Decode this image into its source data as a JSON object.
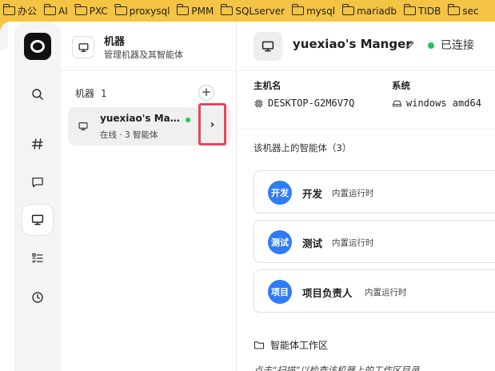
{
  "bookmarks": [
    {
      "label": "办公",
      "icon": "folder-icon"
    },
    {
      "label": "AI",
      "icon": "folder-icon"
    },
    {
      "label": "PXC",
      "icon": "folder-icon"
    },
    {
      "label": "proxysql",
      "icon": "folder-icon"
    },
    {
      "label": "PMM",
      "icon": "folder-icon"
    },
    {
      "label": "SQLserver",
      "icon": "folder-icon"
    },
    {
      "label": "mysql",
      "icon": "folder-icon"
    },
    {
      "label": "mariadb",
      "icon": "folder-icon"
    },
    {
      "label": "TIDB",
      "icon": "folder-icon"
    },
    {
      "label": "sec",
      "icon": "folder-icon"
    }
  ],
  "rail": {
    "items": [
      {
        "name": "search",
        "icon": "search-icon"
      },
      {
        "name": "channels",
        "icon": "hash-icon"
      },
      {
        "name": "chat",
        "icon": "chat-icon"
      },
      {
        "name": "machines",
        "icon": "monitor-icon",
        "active": true
      },
      {
        "name": "tasks",
        "icon": "checklist-icon"
      },
      {
        "name": "history",
        "icon": "clock-icon"
      }
    ]
  },
  "panel": {
    "title": "机器",
    "subtitle": "管理机器及其智能体",
    "list_label": "机器",
    "list_count": "1",
    "add_label": "+",
    "machine": {
      "name": "yuexiao's Mang...",
      "subtitle": "在线 · 3 智能体",
      "status_color": "#22c55e"
    },
    "open_label": "›"
  },
  "detail": {
    "title": "yuexiao's Manger",
    "status": "已连接",
    "status_color": "#22c55e",
    "hostname_label": "主机名",
    "hostname": "DESKTOP-G2M6V7Q",
    "system_label": "系统",
    "system": "windows amd64",
    "agents_label": "该机器上的智能体（3）",
    "agents": [
      {
        "badge": "开发",
        "name": "开发",
        "tag": "内置运行时"
      },
      {
        "badge": "测试",
        "name": "测试",
        "tag": "内置运行时"
      },
      {
        "badge": "项目",
        "name": "项目负责人",
        "tag": "内置运行时"
      }
    ],
    "workspace_label": "智能体工作区",
    "workspace_hint": "点击“扫描”以检查该机器上的工作区目录"
  },
  "colors": {
    "accent_blue": "#2f7cf6",
    "online_green": "#22c55e",
    "highlight_red": "#e4475b"
  }
}
